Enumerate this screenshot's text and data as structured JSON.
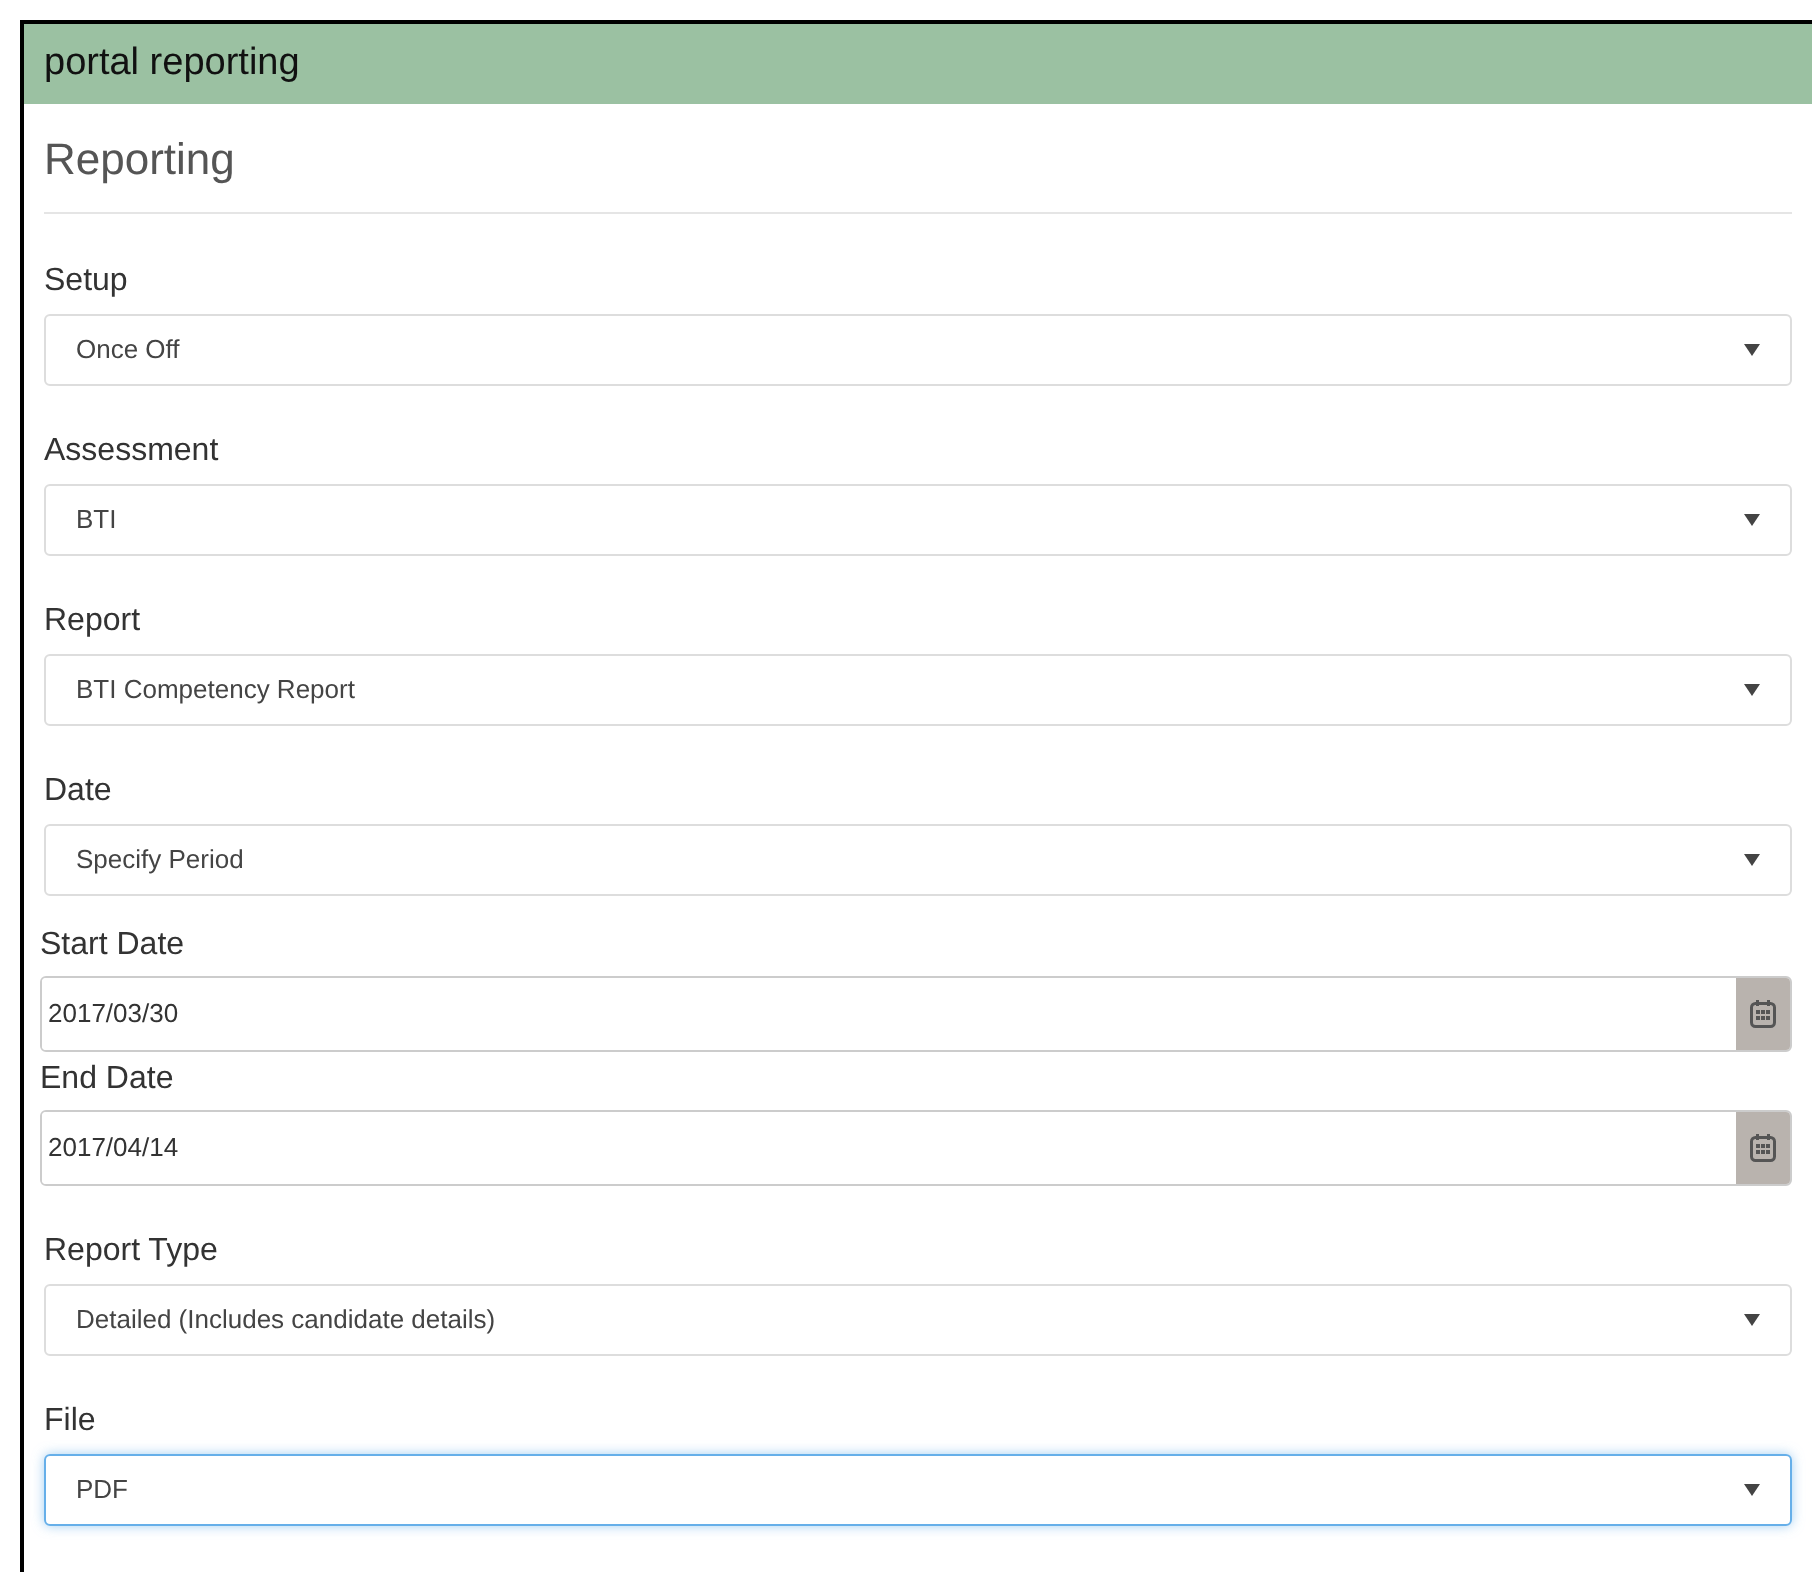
{
  "header": {
    "title": "portal reporting"
  },
  "page_title": "Reporting",
  "fields": [
    {
      "kind": "select",
      "label": "Setup",
      "value": "Once Off",
      "focused": false
    },
    {
      "kind": "select",
      "label": "Assessment",
      "value": "BTI",
      "focused": false
    },
    {
      "kind": "select",
      "label": "Report",
      "value": "BTI Competency Report",
      "focused": false
    },
    {
      "kind": "select",
      "label": "Date",
      "value": "Specify Period",
      "focused": false
    },
    {
      "kind": "date",
      "label": "Start Date",
      "value": "2017/03/30"
    },
    {
      "kind": "date",
      "label": "End Date",
      "value": "2017/04/14"
    },
    {
      "kind": "select",
      "label": "Report Type",
      "value": "Detailed (Includes candidate details)",
      "focused": false
    },
    {
      "kind": "select",
      "label": "File",
      "value": "PDF",
      "focused": true
    }
  ]
}
